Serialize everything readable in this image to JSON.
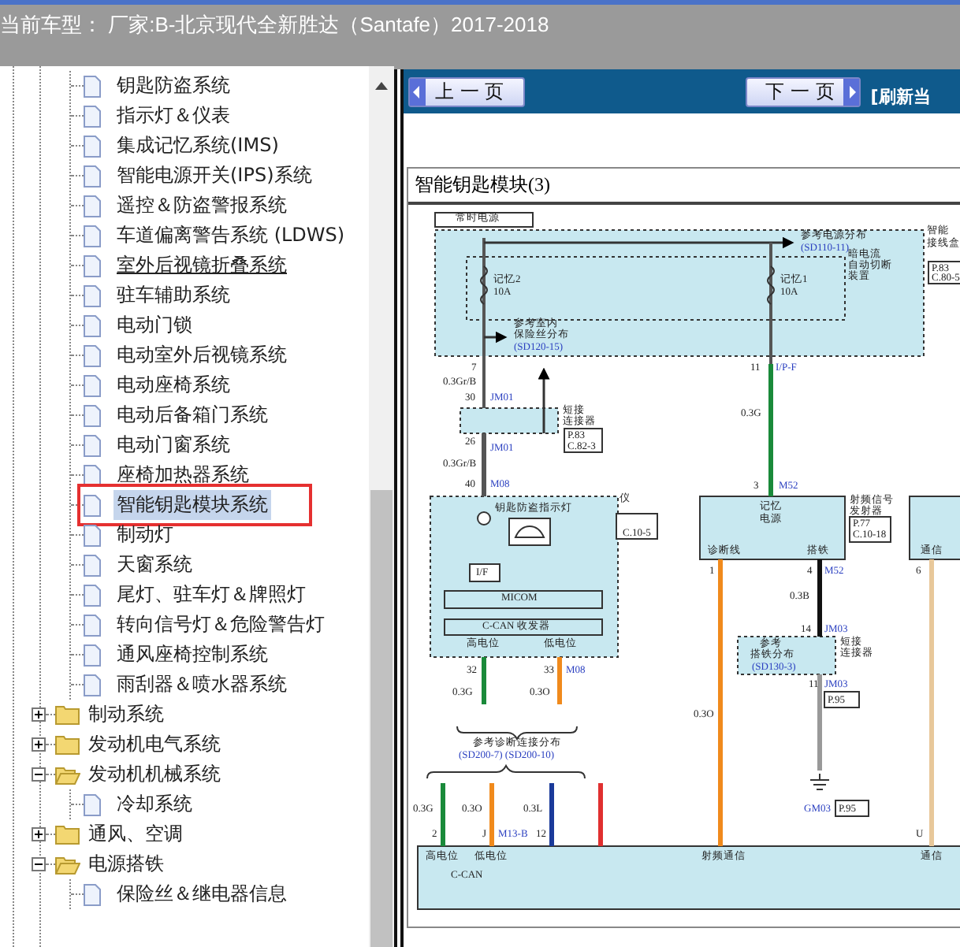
{
  "header": {
    "text": "当前车型： 厂家:B-北京现代全新胜达（Santafe）2017-2018"
  },
  "tree": {
    "items": [
      {
        "kind": "folder",
        "expanded": true,
        "children": [
          {
            "kind": "page",
            "label": "钥匙防盗系统",
            "selected": false,
            "hovered": false
          },
          {
            "kind": "page",
            "label": "指示灯＆仪表",
            "selected": false,
            "hovered": false
          },
          {
            "kind": "page",
            "label": "集成记忆系统(IMS)",
            "selected": false,
            "hovered": false
          },
          {
            "kind": "page",
            "label": "智能电源开关(IPS)系统",
            "selected": false,
            "hovered": false
          },
          {
            "kind": "page",
            "label": "遥控＆防盗警报系统",
            "selected": false,
            "hovered": false
          },
          {
            "kind": "page",
            "label": "车道偏离警告系统 (LDWS)",
            "selected": false,
            "hovered": false
          },
          {
            "kind": "page",
            "label": "室外后视镜折叠系统",
            "selected": false,
            "hovered": true
          },
          {
            "kind": "page",
            "label": "驻车辅助系统",
            "selected": false,
            "hovered": false
          },
          {
            "kind": "page",
            "label": "电动门锁",
            "selected": false,
            "hovered": false
          },
          {
            "kind": "page",
            "label": "电动室外后视镜系统",
            "selected": false,
            "hovered": false
          },
          {
            "kind": "page",
            "label": "电动座椅系统",
            "selected": false,
            "hovered": false
          },
          {
            "kind": "page",
            "label": "电动后备箱门系统",
            "selected": false,
            "hovered": false
          },
          {
            "kind": "page",
            "label": "电动门窗系统",
            "selected": false,
            "hovered": false
          },
          {
            "kind": "page",
            "label": "座椅加热器系统",
            "selected": false,
            "hovered": false
          },
          {
            "kind": "page",
            "label": "智能钥匙模块系统",
            "selected": true,
            "hovered": false
          },
          {
            "kind": "page",
            "label": "制动灯",
            "selected": false,
            "hovered": false
          },
          {
            "kind": "page",
            "label": "天窗系统",
            "selected": false,
            "hovered": false
          },
          {
            "kind": "page",
            "label": "尾灯、驻车灯＆牌照灯",
            "selected": false,
            "hovered": false
          },
          {
            "kind": "page",
            "label": "转向信号灯＆危险警告灯",
            "selected": false,
            "hovered": false
          },
          {
            "kind": "page",
            "label": "通风座椅控制系统",
            "selected": false,
            "hovered": false
          },
          {
            "kind": "page",
            "label": "雨刮器＆喷水器系统",
            "selected": false,
            "hovered": false
          }
        ]
      },
      {
        "kind": "folder",
        "label": "制动系统",
        "expanded": false
      },
      {
        "kind": "folder",
        "label": "发动机电气系统",
        "expanded": false
      },
      {
        "kind": "folder",
        "label": "发动机机械系统",
        "expanded": true,
        "children": [
          {
            "kind": "page",
            "label": "冷却系统",
            "selected": false,
            "hovered": false
          }
        ]
      },
      {
        "kind": "folder",
        "label": "通风、空调",
        "expanded": false
      },
      {
        "kind": "folder",
        "label": "电源搭铁",
        "expanded": true,
        "children": [
          {
            "kind": "page",
            "label": "保险丝＆继电器信息",
            "selected": false,
            "hovered": false
          }
        ]
      }
    ]
  },
  "toolbar": {
    "prev": "上 一 页",
    "next": "下 一 页",
    "refresh": "[刷新当"
  },
  "diagram": {
    "title": "智能钥匙模块(3)",
    "labels": [
      {
        "text": "常时电源",
        "kind": "plain"
      },
      {
        "text": "参考电源分布",
        "kind": "plain"
      },
      {
        "text": "(SD110-11)",
        "kind": "ref"
      },
      {
        "text": "智能",
        "kind": "plain"
      },
      {
        "text": "接线盒",
        "kind": "plain"
      },
      {
        "text": "P.83",
        "kind": "plain"
      },
      {
        "text": "C.80-5",
        "kind": "plain"
      },
      {
        "text": "暗电流",
        "kind": "plain"
      },
      {
        "text": "自动切断",
        "kind": "plain"
      },
      {
        "text": "记忆2",
        "kind": "plain"
      },
      {
        "text": "记忆1",
        "kind": "plain"
      },
      {
        "text": "装置",
        "kind": "plain"
      },
      {
        "text": "10A",
        "kind": "plain"
      },
      {
        "text": "10A",
        "kind": "plain"
      },
      {
        "text": "参考室内",
        "kind": "plain"
      },
      {
        "text": "保险丝分布",
        "kind": "plain"
      },
      {
        "text": "(SD120-15)",
        "kind": "ref"
      },
      {
        "text": "7",
        "kind": "plain"
      },
      {
        "text": "11",
        "kind": "plain"
      },
      {
        "text": "I/P-F",
        "kind": "ref"
      },
      {
        "text": "0.3Gr/B",
        "kind": "plain"
      },
      {
        "text": "30",
        "kind": "plain"
      },
      {
        "text": "JM01",
        "kind": "ref"
      },
      {
        "text": "短接",
        "kind": "plain"
      },
      {
        "text": "连接器",
        "kind": "plain"
      },
      {
        "text": "P.83",
        "kind": "plain"
      },
      {
        "text": "C.82-3",
        "kind": "plain"
      },
      {
        "text": "26",
        "kind": "plain"
      },
      {
        "text": "JM01",
        "kind": "ref"
      },
      {
        "text": "0.3Gr/B",
        "kind": "plain"
      },
      {
        "text": "40",
        "kind": "plain"
      },
      {
        "text": "M08",
        "kind": "ref"
      },
      {
        "text": "0.3G",
        "kind": "plain"
      },
      {
        "text": "3",
        "kind": "plain"
      },
      {
        "text": "M52",
        "kind": "ref"
      },
      {
        "text": "钥匙防盗指示灯",
        "kind": "plain"
      },
      {
        "text": "I/F",
        "kind": "plain"
      },
      {
        "text": "MICOM",
        "kind": "plain"
      },
      {
        "text": "C-CAN 收发器",
        "kind": "plain"
      },
      {
        "text": "高电位",
        "kind": "plain"
      },
      {
        "text": "低电位",
        "kind": "plain"
      },
      {
        "text": "仪",
        "kind": "plain"
      },
      {
        "text": "记忆",
        "kind": "plain"
      },
      {
        "text": "电源",
        "kind": "plain"
      },
      {
        "text": "诊断线",
        "kind": "plain"
      },
      {
        "text": "搭铁",
        "kind": "plain"
      },
      {
        "text": "射频信号",
        "kind": "plain"
      },
      {
        "text": "发射器",
        "kind": "plain"
      },
      {
        "text": "P.77",
        "kind": "plain"
      },
      {
        "text": "C.10-18",
        "kind": "plain"
      },
      {
        "text": "通信",
        "kind": "plain"
      },
      {
        "text": "1",
        "kind": "plain"
      },
      {
        "text": "4",
        "kind": "plain"
      },
      {
        "text": "M52",
        "kind": "ref"
      },
      {
        "text": "6",
        "kind": "plain"
      },
      {
        "text": "0.3B",
        "kind": "plain"
      },
      {
        "text": "14",
        "kind": "plain"
      },
      {
        "text": "JM03",
        "kind": "ref"
      },
      {
        "text": "参考",
        "kind": "plain"
      },
      {
        "text": "搭铁分布",
        "kind": "plain"
      },
      {
        "text": "(SD130-3)",
        "kind": "ref"
      },
      {
        "text": "短接",
        "kind": "plain"
      },
      {
        "text": "连接器",
        "kind": "plain"
      },
      {
        "text": "32",
        "kind": "plain"
      },
      {
        "text": "33",
        "kind": "plain"
      },
      {
        "text": "M08",
        "kind": "ref"
      },
      {
        "text": "0.3G",
        "kind": "plain"
      },
      {
        "text": "0.3O",
        "kind": "plain"
      },
      {
        "text": "0.3O",
        "kind": "plain"
      },
      {
        "text": "11",
        "kind": "plain"
      },
      {
        "text": "JM03",
        "kind": "ref"
      },
      {
        "text": "P.95",
        "kind": "plain"
      },
      {
        "text": "参考诊断连接分布",
        "kind": "plain"
      },
      {
        "text": "(SD200-7) (SD200-10)",
        "kind": "ref"
      },
      {
        "text": "0.3G",
        "kind": "plain"
      },
      {
        "text": "0.3O",
        "kind": "plain"
      },
      {
        "text": "0.3L",
        "kind": "plain"
      },
      {
        "text": "GM03",
        "kind": "ref"
      },
      {
        "text": "P.95",
        "kind": "plain"
      },
      {
        "text": "2",
        "kind": "plain"
      },
      {
        "text": "J",
        "kind": "plain"
      },
      {
        "text": "M13-B",
        "kind": "ref"
      },
      {
        "text": "12",
        "kind": "plain"
      },
      {
        "text": "U",
        "kind": "plain"
      },
      {
        "text": "高电位",
        "kind": "plain"
      },
      {
        "text": "低电位",
        "kind": "plain"
      },
      {
        "text": "C-CAN",
        "kind": "plain"
      },
      {
        "text": "射频通信",
        "kind": "plain"
      },
      {
        "text": "通信",
        "kind": "plain"
      },
      {
        "text": "C.10-5",
        "kind": "plain"
      }
    ]
  }
}
